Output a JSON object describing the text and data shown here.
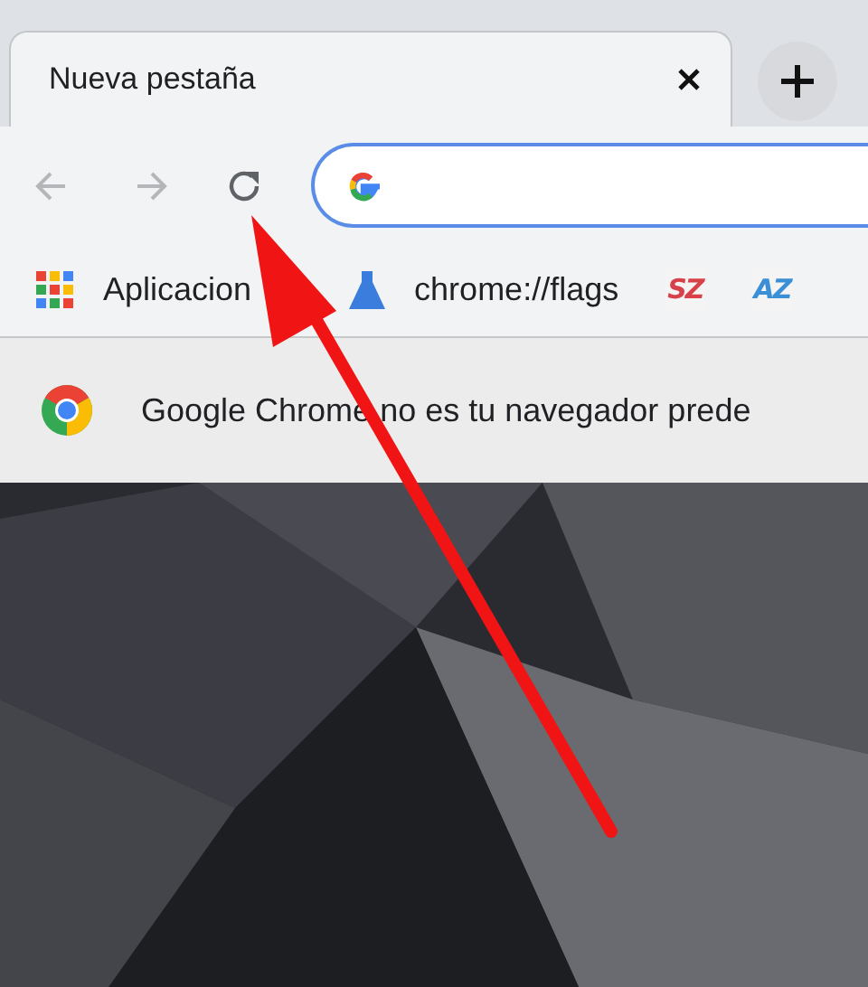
{
  "tabs": [
    {
      "title": "Nueva pestaña",
      "selected": true
    }
  ],
  "nav_buttons": [
    {
      "kind": "back",
      "disabled": true
    },
    {
      "kind": "forward",
      "disabled": true
    },
    {
      "kind": "reload",
      "disabled": false
    }
  ],
  "bookmarks": [
    {
      "kind": "apps",
      "label": "Aplicacion"
    },
    {
      "kind": "flask",
      "label": "chrome://flags"
    },
    {
      "kind": "badge",
      "label": "SZ",
      "color": "#d9414a"
    },
    {
      "kind": "badge",
      "label": "AZ",
      "color": "#3b8fd6"
    }
  ],
  "infobar": {
    "message": "Google Chrome no es tu navegador prede"
  }
}
